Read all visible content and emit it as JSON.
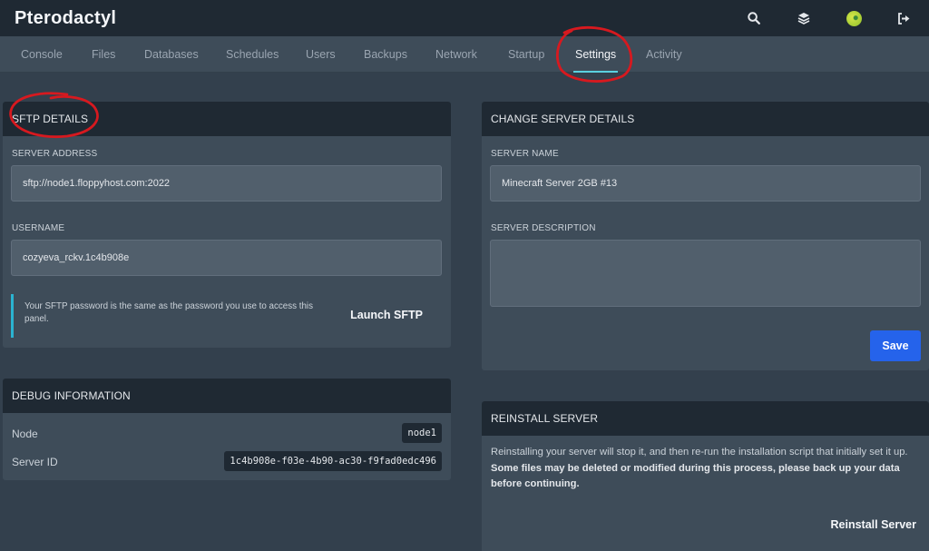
{
  "app": {
    "title": "Pterodactyl"
  },
  "topbar_icons": [
    "search-icon",
    "layers-icon",
    "avatar",
    "logout-icon"
  ],
  "nav": {
    "tabs": [
      {
        "label": "Console"
      },
      {
        "label": "Files"
      },
      {
        "label": "Databases"
      },
      {
        "label": "Schedules"
      },
      {
        "label": "Users"
      },
      {
        "label": "Backups"
      },
      {
        "label": "Network"
      },
      {
        "label": "Startup"
      },
      {
        "label": "Settings",
        "active": true
      },
      {
        "label": "Activity"
      }
    ]
  },
  "sftp": {
    "title": "SFTP DETAILS",
    "address_label": "SERVER ADDRESS",
    "address_value": "sftp://node1.floppyhost.com:2022",
    "username_label": "USERNAME",
    "username_value": "cozyeva_rckv.1c4b908e",
    "info_text": "Your SFTP password is the same as the password you use to access this panel.",
    "launch_label": "Launch SFTP"
  },
  "debug": {
    "title": "DEBUG INFORMATION",
    "node_label": "Node",
    "node_value": "node1",
    "server_id_label": "Server ID",
    "server_id_value": "1c4b908e-f03e-4b90-ac30-f9fad0edc496"
  },
  "change_details": {
    "title": "CHANGE SERVER DETAILS",
    "name_label": "SERVER NAME",
    "name_value": "Minecraft Server 2GB #13",
    "description_label": "SERVER DESCRIPTION",
    "description_value": "",
    "save_label": "Save"
  },
  "reinstall": {
    "title": "REINSTALL SERVER",
    "text_plain": "Reinstalling your server will stop it, and then re-run the installation script that initially set it up.",
    "text_bold": "Some files may be deleted or modified during this process, please back up your data before continuing.",
    "button_label": "Reinstall Server"
  },
  "colors": {
    "topbar": "#1f2933",
    "nav": "#3e4c59",
    "background": "#33404d",
    "accent": "#5ad1e0",
    "save_button": "#2563eb",
    "annotation": "#d7191f"
  }
}
